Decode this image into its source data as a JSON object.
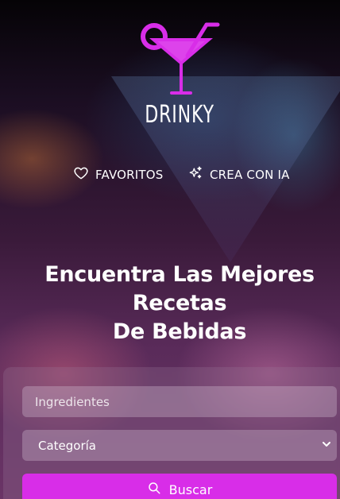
{
  "brand": {
    "name": "DRINKY",
    "accent_color": "#d82de8",
    "logo_icon": "cocktail-glass-icon"
  },
  "nav": {
    "favorites": {
      "label": "FAVORITOS",
      "icon": "heart-icon"
    },
    "create_ai": {
      "label": "CREA CON IA",
      "icon": "sparkles-icon"
    }
  },
  "hero": {
    "title_line1": "Encuentra Las Mejores Recetas",
    "title_line2": "De Bebidas"
  },
  "search_form": {
    "ingredients": {
      "placeholder": "Ingredientes",
      "value": ""
    },
    "category": {
      "selected": "Categoría",
      "icon": "chevron-down-icon"
    },
    "submit": {
      "label": "Buscar",
      "icon": "search-icon"
    }
  }
}
